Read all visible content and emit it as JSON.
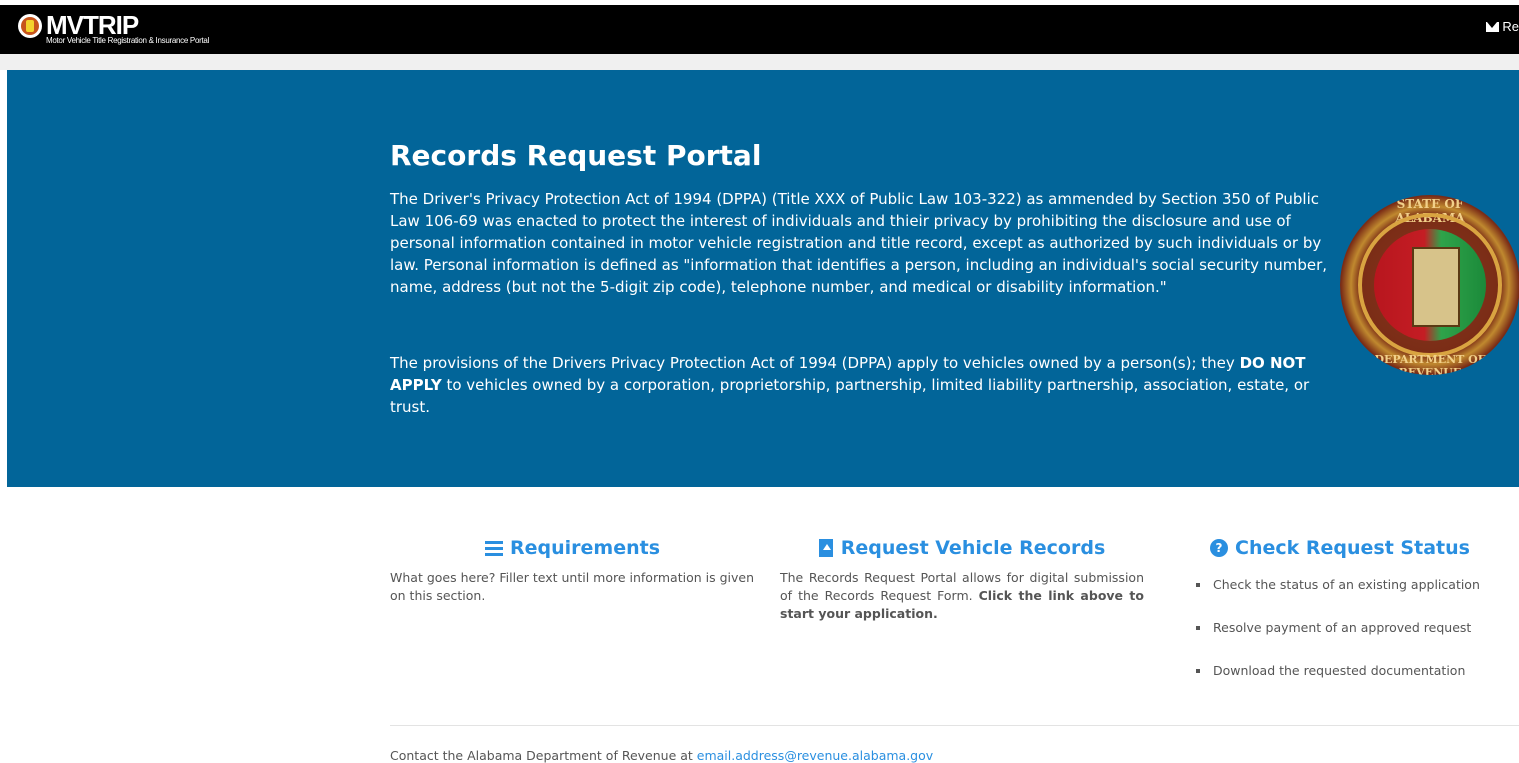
{
  "brand": {
    "name": "MVTRIP",
    "subtitle": "Motor Vehicle Title Registration & Insurance Portal"
  },
  "topnav": {
    "link_label": "Re"
  },
  "hero": {
    "title": "Records Request Portal",
    "paragraph1": "The Driver's Privacy Protection Act of 1994 (DPPA) (Title XXX of Public Law 103-322) as ammended by Section 350 of Public Law 106-69 was enacted to protect the interest of individuals and thieir privacy by prohibiting the disclosure and use of personal information contained in motor vehicle registration and title record, except as authorized by such individuals or by law. Personal information is defined as \"information that identifies a person, including an individual's social security number, name, address (but not the 5-digit zip code), telephone number, and medical or disability information.\"",
    "paragraph2_before": "The provisions of the Drivers Privacy Protection Act of 1994 (DPPA) apply to vehicles owned by a person(s); they ",
    "paragraph2_bold": "DO NOT APPLY",
    "paragraph2_after": " to vehicles owned by a corporation, proprietorship, partnership, limited liability partnership, association, estate, or trust.",
    "seal_top": "STATE OF ALABAMA",
    "seal_bottom": "DEPARTMENT OF REVENUE"
  },
  "columns": {
    "requirements": {
      "title": "Requirements",
      "text": "What goes here? Filler text until more information is given on this section."
    },
    "request": {
      "title": "Request Vehicle Records",
      "text_before": "The Records Request Portal allows for digital submission of the Records Request Form. ",
      "text_bold": "Click the link above to start your application."
    },
    "status": {
      "title": "Check Request Status",
      "items": [
        "Check the status of an existing application",
        "Resolve payment of an approved request",
        "Download the requested documentation"
      ]
    }
  },
  "footer": {
    "text": "Contact the Alabama Department of Revenue at ",
    "email": "email.address@revenue.alabama.gov"
  },
  "colors": {
    "hero_bg": "#026599",
    "accent": "#2a8fe0",
    "topbar": "#000000"
  }
}
